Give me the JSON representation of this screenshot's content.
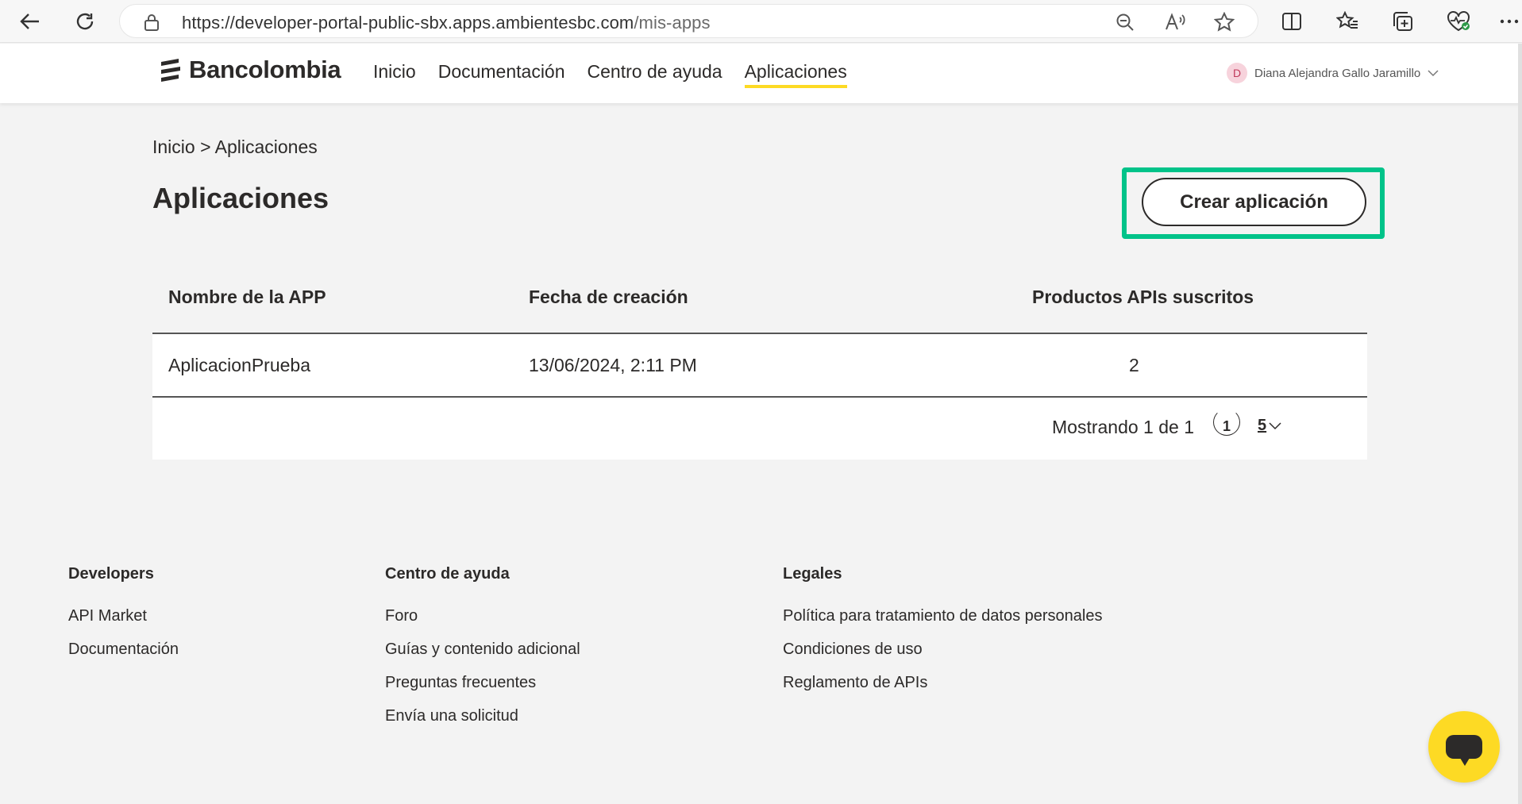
{
  "browser": {
    "url_host": "https://developer-portal-public-sbx.apps.ambientesbc.com",
    "url_path": "/mis-apps",
    "icons": [
      "back-icon",
      "refresh-icon",
      "lock-icon",
      "zoom-out-icon",
      "read-aloud-icon",
      "favorite-star-icon",
      "split-screen-icon",
      "favorites-icon",
      "collections-icon",
      "browser-essentials-icon",
      "more-icon"
    ]
  },
  "header": {
    "logo_text": "Bancolombia",
    "nav": [
      {
        "label": "Inicio"
      },
      {
        "label": "Documentación"
      },
      {
        "label": "Centro de ayuda"
      },
      {
        "label": "Aplicaciones",
        "active": true
      }
    ],
    "user": {
      "initial": "D",
      "name": "Diana Alejandra Gallo Jaramillo"
    }
  },
  "main": {
    "breadcrumb": "Inicio > Aplicaciones",
    "title": "Aplicaciones",
    "create_button": "Crear aplicación",
    "table": {
      "columns": [
        "Nombre de la APP",
        "Fecha de creación",
        "Productos APIs suscritos"
      ],
      "rows": [
        {
          "name": "AplicacionPrueba",
          "date": "13/06/2024, 2:11 PM",
          "apis": "2"
        }
      ],
      "pagination": {
        "summary": "Mostrando 1 de 1",
        "current_page": "1",
        "page_size": "5"
      }
    }
  },
  "footer": {
    "developers": {
      "title": "Developers",
      "links": [
        "API Market",
        "Documentación"
      ]
    },
    "help": {
      "title": "Centro de ayuda",
      "links": [
        "Foro",
        "Guías y contenido adicional",
        "Preguntas frecuentes",
        "Envía una solicitud"
      ]
    },
    "legal": {
      "title": "Legales",
      "links": [
        "Política para tratamiento de datos personales",
        "Condiciones de uso",
        "Reglamento de APIs"
      ]
    }
  },
  "colors": {
    "accent": "#fdda24",
    "highlight": "#00c389",
    "text": "#2c2a29"
  }
}
